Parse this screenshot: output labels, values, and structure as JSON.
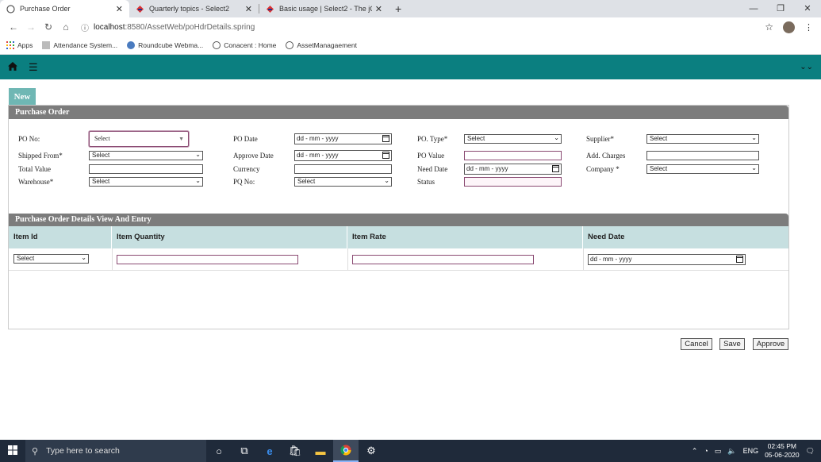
{
  "browser": {
    "tabs": [
      {
        "title": "Purchase Order"
      },
      {
        "title": "Quarterly topics - Select2"
      },
      {
        "title": "Basic usage | Select2 - The jQuery"
      }
    ],
    "url_host": "localhost",
    "url_path": ":8580/AssetWeb/poHdrDetails.spring",
    "bookmarks": [
      "Apps",
      "Attendance System...",
      "Roundcube Webma...",
      "Conacent : Home",
      "AssetManagaement"
    ]
  },
  "page": {
    "new_tab": "New",
    "panel_title": "Purchase Order",
    "labels": {
      "po_no": "PO No:",
      "po_date": "PO Date",
      "po_type": "PO. Type*",
      "supplier": "Supplier*",
      "shipped_from": "Shipped From*",
      "approve_date": "Approve Date",
      "po_value": "PO Value",
      "add_charges": "Add. Charges",
      "total_value": "Total Value",
      "currency": "Currency",
      "need_date": "Need Date",
      "company": "Company *",
      "warehouse": "Warehouse*",
      "pq_no": "PQ No:",
      "status": "Status"
    },
    "select_placeholder": "Select",
    "date_placeholder": "dd - mm - yyyy",
    "details_title": "Purchase Order Details View And Entry",
    "grid_columns": [
      "Item Id",
      "Item Quantity",
      "Item Rate",
      "Need Date"
    ],
    "buttons": {
      "cancel": "Cancel",
      "save": "Save",
      "approve": "Approve"
    }
  },
  "taskbar": {
    "search_placeholder": "Type here to search",
    "lang": "ENG",
    "time": "02:45 PM",
    "date": "05-06-2020"
  }
}
